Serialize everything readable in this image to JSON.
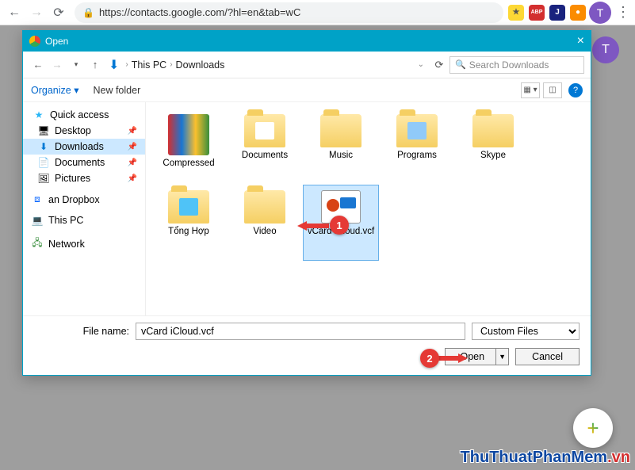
{
  "browser": {
    "url": "https://contacts.google.com/?hl=en&tab=wC",
    "avatar_letter": "T",
    "ext_icons": [
      {
        "name": "star-icon",
        "bg": "#fdd835",
        "txt": "★"
      },
      {
        "name": "abp-icon",
        "bg": "#d32f2f",
        "txt": "ABP"
      },
      {
        "name": "ublock-icon",
        "bg": "#1a237e",
        "txt": "J"
      },
      {
        "name": "cookie-icon",
        "bg": "#fb8c00",
        "txt": "●"
      }
    ]
  },
  "dialog": {
    "title": "Open",
    "crumbs": [
      "This PC",
      "Downloads"
    ],
    "search_placeholder": "Search Downloads",
    "organize": "Organize",
    "new_folder": "New folder",
    "sidebar": {
      "quick_access": "Quick access",
      "items": [
        {
          "label": "Desktop",
          "icon": "desktop-icon",
          "pinned": true,
          "selected": false
        },
        {
          "label": "Downloads",
          "icon": "downloads-icon",
          "pinned": true,
          "selected": true
        },
        {
          "label": "Documents",
          "icon": "documents-icon",
          "pinned": true,
          "selected": false
        },
        {
          "label": "Pictures",
          "icon": "pictures-icon",
          "pinned": true,
          "selected": false
        }
      ],
      "groups": [
        {
          "label": "an Dropbox",
          "icon": "dropbox-icon"
        },
        {
          "label": "This PC",
          "icon": "thispc-icon"
        },
        {
          "label": "Network",
          "icon": "network-icon"
        }
      ]
    },
    "files": [
      {
        "label": "Compressed",
        "type": "compressed",
        "selected": false
      },
      {
        "label": "Documents",
        "type": "folder",
        "selected": false
      },
      {
        "label": "Music",
        "type": "folder",
        "selected": false
      },
      {
        "label": "Programs",
        "type": "folder",
        "selected": false
      },
      {
        "label": "Skype",
        "type": "folder",
        "selected": false
      },
      {
        "label": "Tổng Hợp",
        "type": "folder",
        "selected": false
      },
      {
        "label": "Video",
        "type": "folder",
        "selected": false
      },
      {
        "label": "vCard iCloud.vcf",
        "type": "vcf",
        "selected": true
      }
    ],
    "filename_label": "File name:",
    "filename_value": "vCard iCloud.vcf",
    "filter": "Custom Files",
    "open_btn": "Open",
    "cancel_btn": "Cancel"
  },
  "callouts": {
    "one": "1",
    "two": "2"
  },
  "fab": {
    "plus": "+"
  },
  "watermark": {
    "main": "ThuThuatPhanMem",
    "suffix": ".vn"
  },
  "bg_avatar": "T"
}
